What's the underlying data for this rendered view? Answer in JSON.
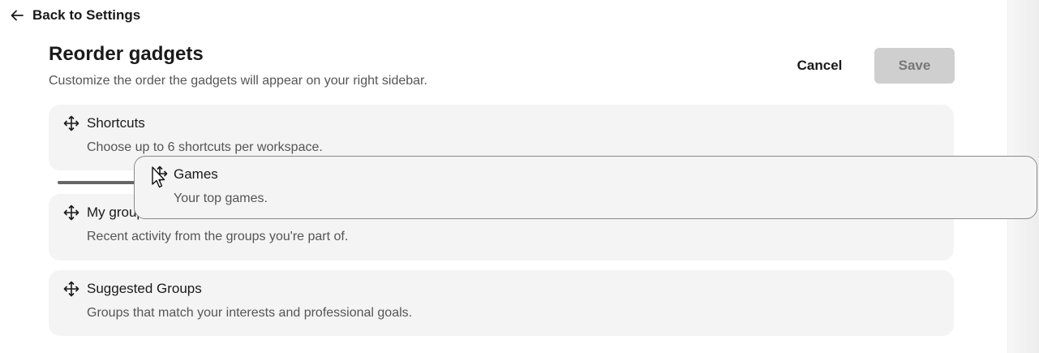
{
  "header": {
    "back_label": "Back to Settings",
    "back_icon": "arrow-left-icon",
    "title": "Reorder gadgets",
    "subtitle": "Customize the order the gadgets will appear on your right sidebar.",
    "cancel_label": "Cancel",
    "save_label": "Save"
  },
  "gadgets": [
    {
      "title": "Shortcuts",
      "description": "Choose up to 6 shortcuts per workspace.",
      "icon": "move-icon"
    },
    {
      "title": "My groups",
      "description": "Recent activity from the groups you're part of.",
      "icon": "move-icon"
    },
    {
      "title": "Suggested Groups",
      "description": "Groups that match your interests and professional goals.",
      "icon": "move-icon"
    }
  ],
  "dragging": {
    "title": "Games",
    "description": "Your top games.",
    "icon": "move-icon"
  },
  "colors": {
    "save_disabled_bg": "#cfcfcf",
    "card_bg": "#f4f4f4",
    "drop_indicator": "#666666"
  }
}
